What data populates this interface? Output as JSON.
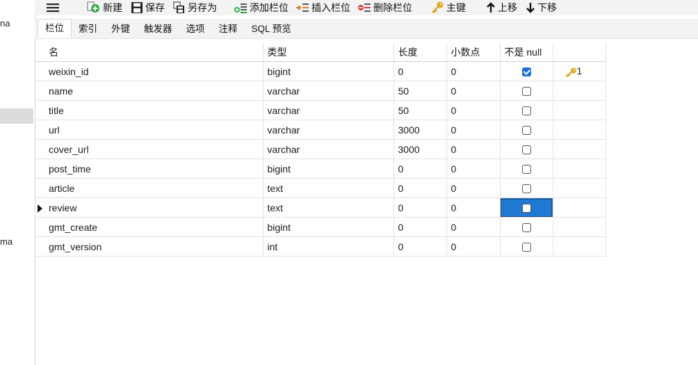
{
  "sidebar": {
    "fragments": [
      "na",
      "ma"
    ]
  },
  "toolbar": {
    "menu_icon": "hamburger-menu-icon",
    "new_label": "新建",
    "save_label": "保存",
    "save_as_label": "另存为",
    "add_field_label": "添加栏位",
    "insert_field_label": "插入栏位",
    "delete_field_label": "删除栏位",
    "primary_key_label": "主键",
    "move_up_label": "上移",
    "move_down_label": "下移"
  },
  "tabs": [
    {
      "label": "栏位",
      "active": true
    },
    {
      "label": "索引"
    },
    {
      "label": "外键"
    },
    {
      "label": "触发器"
    },
    {
      "label": "选项"
    },
    {
      "label": "注释"
    },
    {
      "label": "SQL 预览"
    }
  ],
  "table": {
    "columns": [
      "名",
      "类型",
      "长度",
      "小数点",
      "不是 null",
      ""
    ],
    "rows": [
      {
        "name": "weixin_id",
        "type": "bigint",
        "length": "0",
        "decimals": "0",
        "not_null": true,
        "key": "1"
      },
      {
        "name": "name",
        "type": "varchar",
        "length": "50",
        "decimals": "0",
        "not_null": false,
        "key": ""
      },
      {
        "name": "title",
        "type": "varchar",
        "length": "50",
        "decimals": "0",
        "not_null": false,
        "key": ""
      },
      {
        "name": "url",
        "type": "varchar",
        "length": "3000",
        "decimals": "0",
        "not_null": false,
        "key": ""
      },
      {
        "name": "cover_url",
        "type": "varchar",
        "length": "3000",
        "decimals": "0",
        "not_null": false,
        "key": ""
      },
      {
        "name": "post_time",
        "type": "bigint",
        "length": "0",
        "decimals": "0",
        "not_null": false,
        "key": ""
      },
      {
        "name": "article",
        "type": "text",
        "length": "0",
        "decimals": "0",
        "not_null": false,
        "key": ""
      },
      {
        "name": "review",
        "type": "text",
        "length": "0",
        "decimals": "0",
        "not_null": false,
        "key": "",
        "current": true
      },
      {
        "name": "gmt_create",
        "type": "bigint",
        "length": "0",
        "decimals": "0",
        "not_null": false,
        "key": ""
      },
      {
        "name": "gmt_version",
        "type": "int",
        "length": "0",
        "decimals": "0",
        "not_null": false,
        "key": ""
      }
    ]
  },
  "colors": {
    "selection": "#1f78d1",
    "checkbox_on": "#1a73d9",
    "key_icon": "#e0a81a",
    "add_icon": "#2faa3f",
    "delete_icon": "#d43a3a"
  }
}
